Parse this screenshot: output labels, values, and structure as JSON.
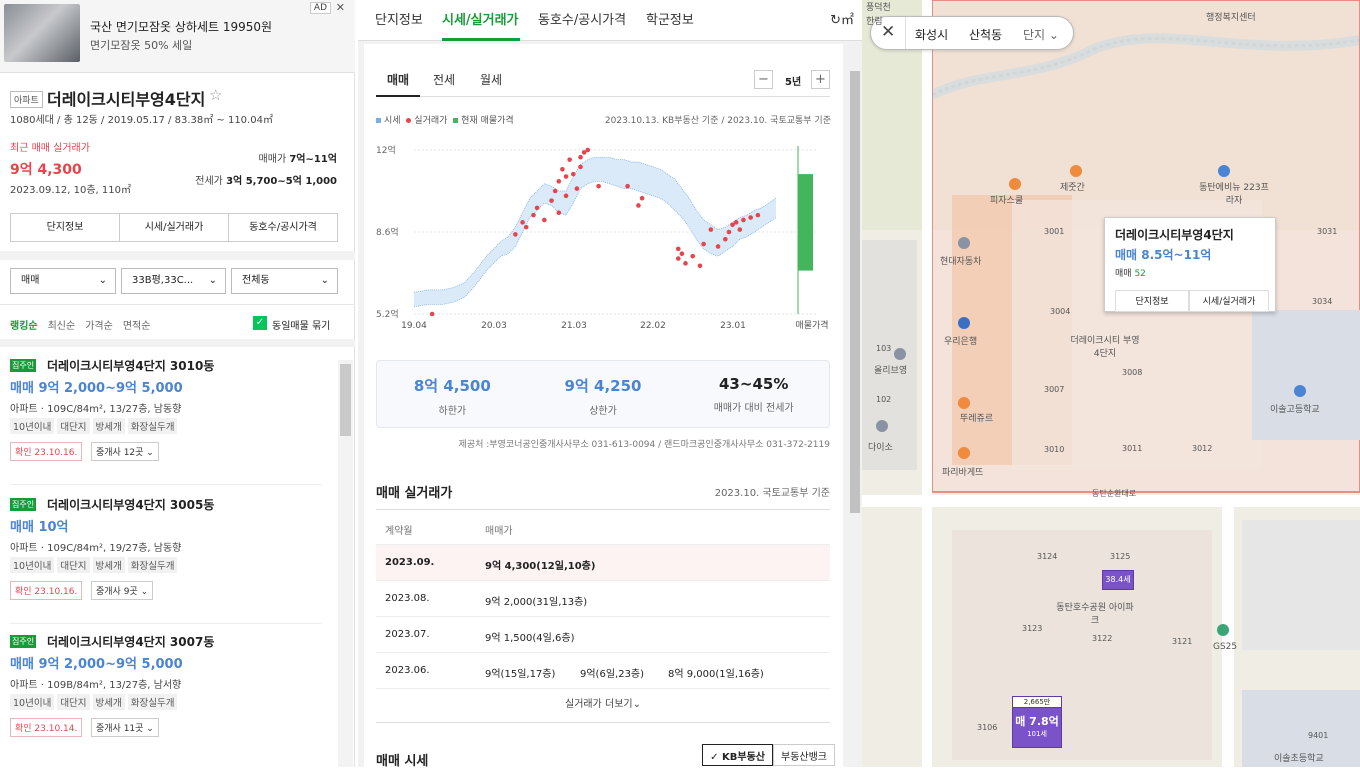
{
  "ad": {
    "title": "국산 면기모잠옷 상하세트 19950원",
    "sub": "면기모잠옷 50% 세일",
    "tag": "AD",
    "close": "✕"
  },
  "complex": {
    "badge": "아파트",
    "name": "더레이크시티부영4단지",
    "star": "☆",
    "meta": "1080세대 / 총 12동 / 2019.05.17 / 83.38㎡ ~ 110.04㎡",
    "recent_label": "최근 매매 실거래가",
    "recent_price": "9억 4,300",
    "recent_date": "2023.09.12, 10층, 110㎡",
    "sale_label": "매매가",
    "sale_range": "7억~11억",
    "lease_label": "전세가",
    "lease_range": "3억 5,700~5억 1,000",
    "buttons": [
      "단지정보",
      "시세/실거래가",
      "동호수/공시가격"
    ]
  },
  "filters": {
    "type": "매매",
    "area": "33B평,33C...",
    "dong": "전체동",
    "chev": "⌄"
  },
  "sort": {
    "tabs": [
      "랭킹순",
      "최신순",
      "가격순",
      "면적순"
    ],
    "check_mark": "✓",
    "group_label": "동일매물 묶기"
  },
  "listings": [
    {
      "tag": "집주인",
      "name": "더레이크시티부영4단지 3010동",
      "price": "매매 9억 2,000~9억 5,000",
      "spec": "아파트 · 109C/84m², 13/27층, 남동향",
      "tags": [
        "10년이내",
        "대단지",
        "방세개",
        "화장실두개"
      ],
      "confirm": "확인 23.10.16.",
      "agent": "중개사 12곳 ⌄"
    },
    {
      "tag": "집주인",
      "name": "더레이크시티부영4단지 3005동",
      "price": "매매 10억",
      "spec": "아파트 · 109C/84m², 19/27층, 남동향",
      "tags": [
        "10년이내",
        "대단지",
        "방세개",
        "화장실두개"
      ],
      "confirm": "확인 23.10.16.",
      "agent": "중개사 9곳 ⌄"
    },
    {
      "tag": "집주인",
      "name": "더레이크시티부영4단지 3007동",
      "price": "매매 9억 2,000~9억 5,000",
      "spec": "아파트 · 109B/84m², 13/27층, 남서향",
      "tags": [
        "10년이내",
        "대단지",
        "방세개",
        "화장실두개"
      ],
      "confirm": "확인 23.10.14.",
      "agent": "중개사 11곳 ⌄"
    }
  ],
  "tabs": {
    "items": [
      "단지정보",
      "시세/실거래가",
      "동호수/공시가격",
      "학군정보"
    ],
    "refresh": "↻㎡"
  },
  "subtabs": {
    "items": [
      "매매",
      "전세",
      "월세"
    ],
    "minus": "−",
    "plus": "+",
    "period": "5년"
  },
  "legend": {
    "items": [
      "시세",
      "실거래가",
      "현재 매물가격"
    ],
    "basis": "2023.10.13. KB부동산 기준 / 2023.10. 국토교통부 기준"
  },
  "colors": {
    "market": "#7ab0e8",
    "deal": "#e5454d",
    "listing": "#43b55a",
    "accent": "#1a9b3a",
    "blue": "#4a84d4"
  },
  "chart_data": {
    "type": "line",
    "ylim": [
      5.2,
      12
    ],
    "yticks": [
      "12억",
      "8.6억",
      "5.2억"
    ],
    "yvals": [
      12,
      8.6,
      5.2
    ],
    "xlabels": [
      "19.04",
      "20.03",
      "21.03",
      "22.02",
      "23.01",
      "매물가격"
    ],
    "market_band": {
      "x": [
        0,
        4,
        8,
        11,
        14,
        17,
        20,
        22,
        24,
        26,
        28,
        30,
        32,
        34,
        36,
        38,
        40,
        42,
        44,
        46,
        48,
        50,
        52,
        54,
        56,
        58,
        60,
        62,
        64,
        66,
        68,
        70,
        72,
        74,
        76,
        78,
        80,
        82,
        84,
        86,
        88,
        90,
        92,
        94,
        96,
        98,
        100
      ],
      "low": [
        5.5,
        5.6,
        5.6,
        5.7,
        5.9,
        6.4,
        7.0,
        7.3,
        7.6,
        7.7,
        8.0,
        8.6,
        9.2,
        9.5,
        9.8,
        9.7,
        9.4,
        9.3,
        9.8,
        10.4,
        10.6,
        10.7,
        10.7,
        10.6,
        10.5,
        10.4,
        10.4,
        10.3,
        10.2,
        10.1,
        10.0,
        9.8,
        9.5,
        9.2,
        8.8,
        8.3,
        7.9,
        7.7,
        7.6,
        7.8,
        8.0,
        8.3,
        8.4,
        8.6,
        8.8,
        9.0,
        9.2
      ],
      "high": [
        6.1,
        6.2,
        6.2,
        6.3,
        6.5,
        7.0,
        7.6,
        7.9,
        8.2,
        8.4,
        8.8,
        9.4,
        10.0,
        10.3,
        10.6,
        10.5,
        10.3,
        10.3,
        10.9,
        11.4,
        11.6,
        11.7,
        11.7,
        11.7,
        11.6,
        11.6,
        11.5,
        11.5,
        11.4,
        11.3,
        11.2,
        11.0,
        10.8,
        10.4,
        10.0,
        9.5,
        9.1,
        8.9,
        8.7,
        8.8,
        9.0,
        9.2,
        9.3,
        9.5,
        9.6,
        9.8,
        10.0
      ]
    },
    "deals": [
      [
        5,
        5.2
      ],
      [
        28,
        8.5
      ],
      [
        30,
        9.0
      ],
      [
        31,
        8.8
      ],
      [
        33,
        9.3
      ],
      [
        34,
        9.6
      ],
      [
        36,
        9.1
      ],
      [
        38,
        9.9
      ],
      [
        39,
        10.3
      ],
      [
        40,
        9.4
      ],
      [
        40,
        10.7
      ],
      [
        41,
        11.2
      ],
      [
        42,
        10.9
      ],
      [
        42,
        10.1
      ],
      [
        43,
        11.6
      ],
      [
        44,
        11.0
      ],
      [
        45,
        10.4
      ],
      [
        46,
        11.7
      ],
      [
        46,
        11.3
      ],
      [
        47,
        11.9
      ],
      [
        48,
        12.0
      ],
      [
        51,
        10.5
      ],
      [
        59,
        10.5
      ],
      [
        62,
        9.7
      ],
      [
        63,
        10.0
      ],
      [
        73,
        7.9
      ],
      [
        73,
        7.5
      ],
      [
        74,
        7.7
      ],
      [
        75,
        7.3
      ],
      [
        77,
        7.6
      ],
      [
        79,
        7.2
      ],
      [
        80,
        8.1
      ],
      [
        82,
        8.7
      ],
      [
        84,
        8.0
      ],
      [
        86,
        8.3
      ],
      [
        87,
        8.6
      ],
      [
        88,
        8.9
      ],
      [
        89,
        9.0
      ],
      [
        90,
        8.7
      ],
      [
        91,
        9.1
      ],
      [
        93,
        9.2
      ],
      [
        95,
        9.3
      ]
    ],
    "listing_range": [
      7,
      11
    ]
  },
  "stats": [
    {
      "v": "8억 4,500",
      "l": "하한가"
    },
    {
      "v": "9억 4,250",
      "l": "상한가"
    },
    {
      "v": "43~45%",
      "l": "매매가 대비 전세가"
    }
  ],
  "provider": "제공처 :부영코너공인중개사사무소 031-613-0094 / 랜드마크공인중개사사무소 031-372-2119",
  "deals_section": {
    "title": "매매 실거래가",
    "basis": "2023.10. 국토교통부 기준",
    "head": [
      "계약월",
      "매매가"
    ],
    "rows": [
      [
        "2023.09.",
        "9억 4,300(12일,10층)",
        "",
        ""
      ],
      [
        "2023.08.",
        "9억 2,000(31일,13층)",
        "",
        ""
      ],
      [
        "2023.07.",
        "9억 1,500(4일,6층)",
        "",
        ""
      ],
      [
        "2023.06.",
        "9억(15일,17층)",
        "9억(6일,23층)",
        "8억 9,000(1일,16층)"
      ]
    ],
    "more": "실거래가 더보기⌄"
  },
  "market_section": {
    "title": "매매 시세",
    "tabs": [
      "✓ KB부동산",
      "부동산뱅크"
    ]
  },
  "map": {
    "close": "✕",
    "region": [
      "화성시",
      "산척동",
      "단지 ⌄"
    ],
    "card": {
      "name": "더레이크시티부영4단지",
      "price": "매매 8.5억~11억",
      "count_label": "매매",
      "count": "52",
      "buttons": [
        "단지정보",
        "시세/실거래가"
      ]
    },
    "labels": [
      "동탄호수공원 아이파크",
      "이솔고등학교",
      "이솔초등학교",
      "동탄에비뉴 223프라자",
      "현대자동차",
      "우리은행",
      "올리브영",
      "다이소",
      "파리바게뜨",
      "뚜레쥬르",
      "피자스쿨",
      "제줏간",
      "GS25",
      "더레이크시티 부영4단지",
      "동탄순환대로",
      "3001",
      "3004",
      "3007",
      "3008",
      "3010",
      "3011",
      "3012",
      "3031",
      "3034",
      "3124",
      "3125",
      "3123",
      "3122",
      "3121",
      "3106",
      "9401",
      "102",
      "103",
      "풍덕천",
      "행정복지센터",
      "한림"
    ],
    "pins": [
      {
        "top": "2,665만",
        "main": "매 7.8억",
        "sub": "101세"
      },
      {
        "top": "",
        "main": "38.4세",
        "sub": ""
      }
    ]
  }
}
